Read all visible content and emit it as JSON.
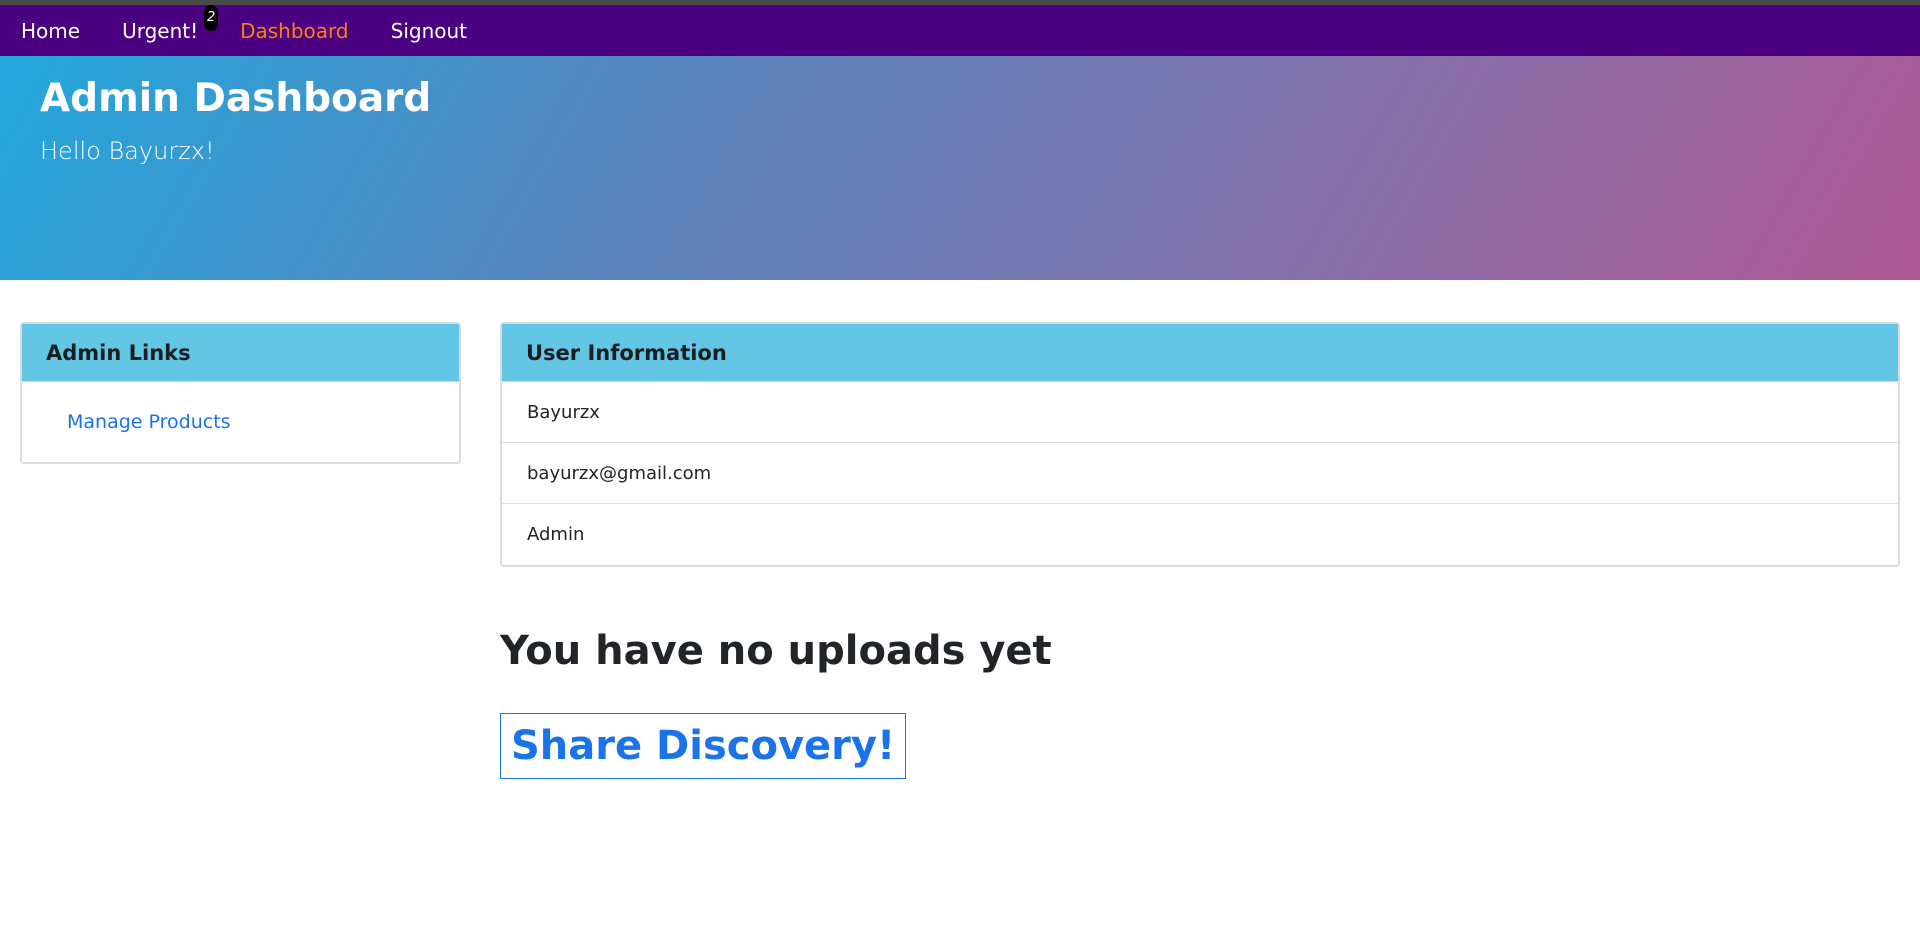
{
  "nav": {
    "items": [
      {
        "label": "Home",
        "active": false
      },
      {
        "label": "Urgent!",
        "badge": "2",
        "active": false
      },
      {
        "label": "Dashboard",
        "active": true
      },
      {
        "label": "Signout",
        "active": false
      }
    ]
  },
  "hero": {
    "title": "Admin Dashboard",
    "subtitle": "Hello Bayurzx!"
  },
  "admin_links": {
    "title": "Admin Links",
    "items": [
      "Manage Products"
    ]
  },
  "user_info": {
    "title": "User Information",
    "rows": [
      "Bayurzx",
      "bayurzx@gmail.com",
      "Admin"
    ]
  },
  "uploads": {
    "empty_message": "You have no uploads yet",
    "share_label": "Share Discovery!"
  },
  "colors": {
    "navbar": "#4b0082",
    "nav_active": "#fd7e14",
    "card_header": "#62c6e4",
    "link": "#1a73e8"
  }
}
